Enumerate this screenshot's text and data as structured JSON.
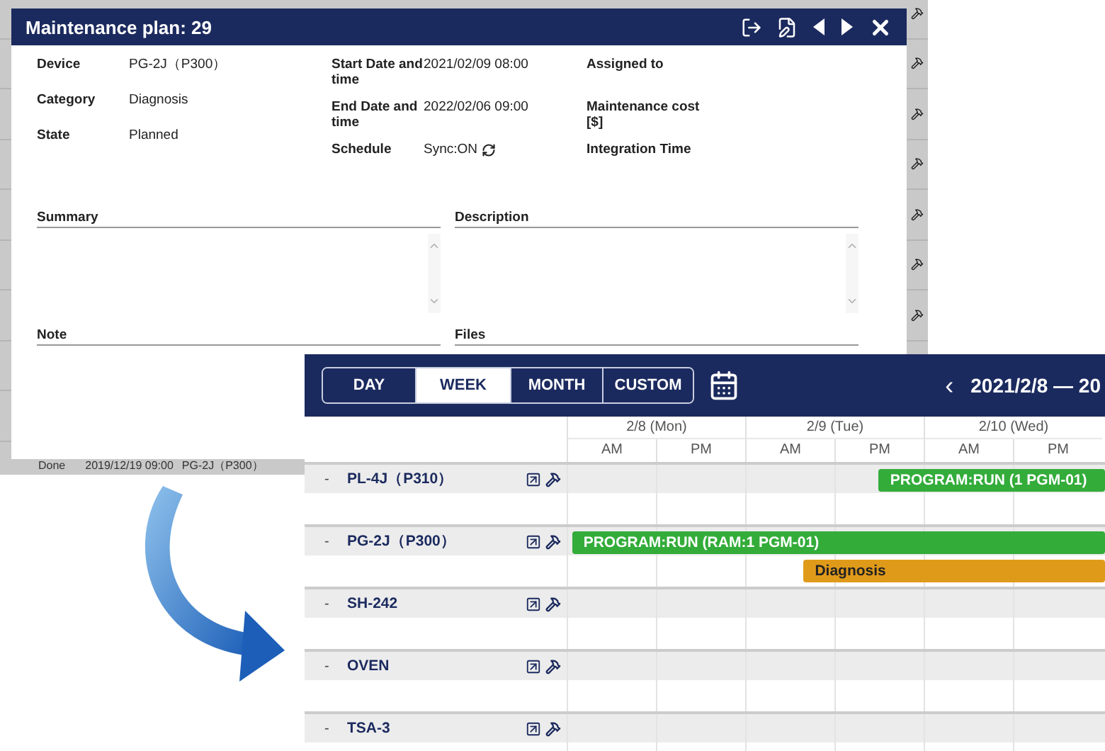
{
  "background_list": {
    "last_row": {
      "state": "Done",
      "date": "2019/12/19 09:00",
      "device": "PG-2J（P300）"
    }
  },
  "dialog": {
    "title": "Maintenance plan: 29",
    "field_columns": [
      [
        {
          "label": "Device",
          "value": "PG-2J（P300）",
          "kind": "text"
        },
        {
          "label": "Category",
          "value": "Diagnosis",
          "kind": "text"
        },
        {
          "label": "State",
          "value": "Planned",
          "kind": "text"
        }
      ],
      [
        {
          "label": "Start Date and time",
          "value": "2021/02/09 08:00",
          "kind": "text"
        },
        {
          "label": "End Date and time",
          "value": "2022/02/06 09:00",
          "kind": "text"
        },
        {
          "label": "Schedule",
          "value": "Sync:ON",
          "kind": "sync"
        }
      ],
      [
        {
          "label": "Assigned to"
        },
        {
          "label": "Maintenance cost [$]"
        },
        {
          "label": "Integration Time"
        }
      ]
    ],
    "sections": [
      {
        "label": "Summary",
        "kind": "textarea"
      },
      {
        "label": "Description",
        "kind": "textarea"
      },
      {
        "label": "Note",
        "kind": "plain"
      },
      {
        "label": "Files",
        "kind": "plain"
      }
    ]
  },
  "schedule": {
    "views": [
      {
        "label": "DAY",
        "selected": false
      },
      {
        "label": "WEEK",
        "selected": true
      },
      {
        "label": "MONTH",
        "selected": false
      },
      {
        "label": "CUSTOM",
        "selected": false
      }
    ],
    "prev": "‹",
    "range": "2021/2/8 — 20",
    "days": [
      "2/8 (Mon)",
      "2/9 (Tue)",
      "2/10 (Wed)"
    ],
    "halves": [
      "AM",
      "PM",
      "AM",
      "PM",
      "AM",
      "PM"
    ],
    "devices": [
      {
        "toggle": "-",
        "name": "PL-4J（P310）",
        "bars": [
          {
            "label": "PROGRAM:RUN (1 PGM-01)",
            "color": "#33ac3a",
            "level": 0.42,
            "kind": "upper"
          }
        ]
      },
      {
        "toggle": "-",
        "name": "PG-2J（P300）",
        "bars": [
          {
            "label": "PROGRAM:RUN (RAM:1 PGM-01)",
            "color": "#33ac3a",
            "level": 0.99,
            "kind": "upper"
          },
          {
            "label": "Diagnosis",
            "color": "#e09a1a",
            "level": 0.56,
            "kind": "lower"
          }
        ]
      },
      {
        "toggle": "-",
        "name": "SH-242"
      },
      {
        "toggle": "-",
        "name": "OVEN"
      },
      {
        "toggle": "-",
        "name": "TSA-3"
      }
    ]
  }
}
